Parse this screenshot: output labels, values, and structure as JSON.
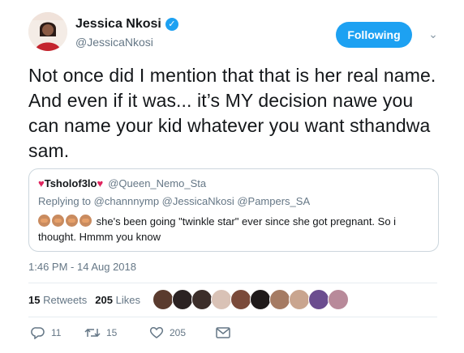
{
  "author": {
    "name": "Jessica Nkosi",
    "handle": "@JessicaNkosi",
    "verified_badge": "✓"
  },
  "follow_button": {
    "label": "Following"
  },
  "caret_icon": "⌄",
  "tweet": {
    "text": "Not once did I mention that that is her real name. And even if it was... it’s MY decision nawe you can name your kid whatever you want sthandwa sam."
  },
  "quoted_tweet": {
    "name": "Tsholof3lo",
    "handle": "@Queen_Nemo_Sta",
    "replying_label": "Replying to @channnymp @JessicaNkosi @Pampers_SA",
    "text": "she's been going \"twinkle star\" ever since she got pregnant.  So i thought.  Hmmm you know"
  },
  "timestamp": "1:46 PM - 14 Aug 2018",
  "stats": {
    "retweets_count": "15",
    "retweets_label": "Retweets",
    "likes_count": "205",
    "likes_label": "Likes"
  },
  "liker_colors": [
    "#5a3b2e",
    "#2b2222",
    "#3c2e2a",
    "#d9c2b6",
    "#7a4a3a",
    "#1f1a1a",
    "#a57b63",
    "#c9a58f",
    "#6b4d8f",
    "#b88a9a"
  ],
  "actions": {
    "replies": "11",
    "retweets": "15",
    "likes": "205"
  },
  "colors": {
    "accent": "#1da1f2",
    "text": "#14171a",
    "muted": "#657786"
  }
}
